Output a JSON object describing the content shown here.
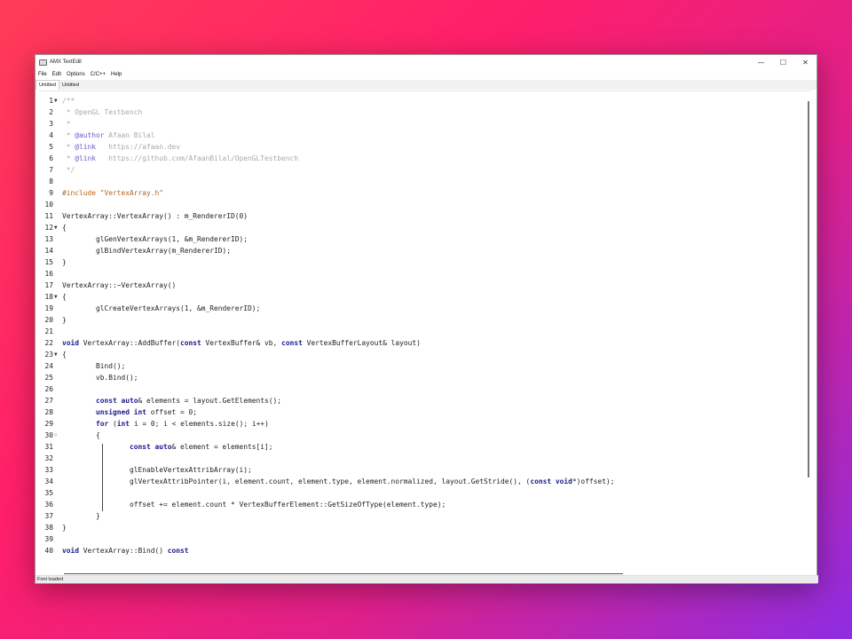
{
  "window": {
    "title": "AMX TextEdit",
    "controls": {
      "minimize": "—",
      "maximize": "☐",
      "close": "✕"
    }
  },
  "menu": [
    "File",
    "Edit",
    "Options",
    "C/C++",
    "Help"
  ],
  "tabs": [
    {
      "label": "Untitled",
      "active": true
    },
    {
      "label": "Untitled",
      "active": false
    }
  ],
  "status": "Font loaded",
  "icons": {
    "app": "text-editor-icon",
    "fold_open": "triangle-down-icon",
    "fold_inner": "triangle-down-outline-icon"
  },
  "colors": {
    "comment": "#a9a9a9",
    "tag": "#6a5acd",
    "preprocessor": "#b5651d",
    "keyword": "#1a1a8c",
    "text": "#222222"
  },
  "code_lines": [
    {
      "n": "1",
      "fold": "open",
      "tokens": [
        [
          "comment",
          "/**"
        ]
      ]
    },
    {
      "n": "2",
      "tokens": [
        [
          "comment",
          " * OpenGL Testbench"
        ]
      ]
    },
    {
      "n": "3",
      "tokens": [
        [
          "comment",
          " *"
        ]
      ]
    },
    {
      "n": "4",
      "tokens": [
        [
          "comment",
          " * "
        ],
        [
          "tag",
          "@author"
        ],
        [
          "comment",
          " Afaan Bilal"
        ]
      ]
    },
    {
      "n": "5",
      "tokens": [
        [
          "comment",
          " * "
        ],
        [
          "tag",
          "@link"
        ],
        [
          "comment",
          "   https://afaan.dev"
        ]
      ]
    },
    {
      "n": "6",
      "tokens": [
        [
          "comment",
          " * "
        ],
        [
          "tag",
          "@link"
        ],
        [
          "comment",
          "   https://github.com/AfaanBilal/OpenGLTestbench"
        ]
      ]
    },
    {
      "n": "7",
      "tokens": [
        [
          "comment",
          " */"
        ]
      ]
    },
    {
      "n": "8",
      "tokens": []
    },
    {
      "n": "9",
      "tokens": [
        [
          "pre",
          "#include \"VertexArray.h\""
        ]
      ]
    },
    {
      "n": "10",
      "tokens": []
    },
    {
      "n": "11",
      "tokens": [
        [
          "plain",
          "VertexArray::VertexArray() : m_RendererID(0)"
        ]
      ]
    },
    {
      "n": "12",
      "fold": "open",
      "tokens": [
        [
          "plain",
          "{"
        ]
      ]
    },
    {
      "n": "13",
      "tokens": [
        [
          "plain",
          "        glGenVertexArrays(1, &m_RendererID);"
        ]
      ]
    },
    {
      "n": "14",
      "tokens": [
        [
          "plain",
          "        glBindVertexArray(m_RendererID);"
        ]
      ]
    },
    {
      "n": "15",
      "tokens": [
        [
          "plain",
          "}"
        ]
      ]
    },
    {
      "n": "16",
      "tokens": []
    },
    {
      "n": "17",
      "tokens": [
        [
          "plain",
          "VertexArray::~VertexArray()"
        ]
      ]
    },
    {
      "n": "18",
      "fold": "open",
      "tokens": [
        [
          "plain",
          "{"
        ]
      ]
    },
    {
      "n": "19",
      "tokens": [
        [
          "plain",
          "        glCreateVertexArrays(1, &m_RendererID);"
        ]
      ]
    },
    {
      "n": "20",
      "tokens": [
        [
          "plain",
          "}"
        ]
      ]
    },
    {
      "n": "21",
      "tokens": []
    },
    {
      "n": "22",
      "tokens": [
        [
          "kw",
          "void"
        ],
        [
          "plain",
          " VertexArray::AddBuffer("
        ],
        [
          "kw",
          "const"
        ],
        [
          "plain",
          " VertexBuffer& vb, "
        ],
        [
          "kw",
          "const"
        ],
        [
          "plain",
          " VertexBufferLayout& layout)"
        ]
      ]
    },
    {
      "n": "23",
      "fold": "open",
      "tokens": [
        [
          "plain",
          "{"
        ]
      ]
    },
    {
      "n": "24",
      "tokens": [
        [
          "plain",
          "        Bind();"
        ]
      ]
    },
    {
      "n": "25",
      "tokens": [
        [
          "plain",
          "        vb.Bind();"
        ]
      ]
    },
    {
      "n": "26",
      "tokens": []
    },
    {
      "n": "27",
      "tokens": [
        [
          "plain",
          "        "
        ],
        [
          "kw",
          "const auto"
        ],
        [
          "plain",
          "& elements = layout.GetElements();"
        ]
      ]
    },
    {
      "n": "28",
      "tokens": [
        [
          "plain",
          "        "
        ],
        [
          "kw",
          "unsigned int"
        ],
        [
          "plain",
          " offset = 0;"
        ]
      ]
    },
    {
      "n": "29",
      "tokens": [
        [
          "plain",
          "        "
        ],
        [
          "kw",
          "for"
        ],
        [
          "plain",
          " ("
        ],
        [
          "kw",
          "int"
        ],
        [
          "plain",
          " i = 0; i < elements.size(); i++)"
        ]
      ]
    },
    {
      "n": "30",
      "fold": "inner",
      "tokens": [
        [
          "plain",
          "        {"
        ]
      ]
    },
    {
      "n": "31",
      "tokens": [
        [
          "plain",
          "                "
        ],
        [
          "kw",
          "const auto"
        ],
        [
          "plain",
          "& element = elements[i];"
        ]
      ]
    },
    {
      "n": "32",
      "tokens": []
    },
    {
      "n": "33",
      "tokens": [
        [
          "plain",
          "                glEnableVertexAttribArray(i);"
        ]
      ]
    },
    {
      "n": "34",
      "tokens": [
        [
          "plain",
          "                glVertexAttribPointer(i, element.count, element.type, element.normalized, layout.GetStride(), ("
        ],
        [
          "kw",
          "const void"
        ],
        [
          "plain",
          "*)offset);"
        ]
      ]
    },
    {
      "n": "35",
      "tokens": []
    },
    {
      "n": "36",
      "tokens": [
        [
          "plain",
          "                offset += element.count * VertexBufferElement::GetSizeOfType(element.type);"
        ]
      ]
    },
    {
      "n": "37",
      "tokens": [
        [
          "plain",
          "        }"
        ]
      ]
    },
    {
      "n": "38",
      "tokens": [
        [
          "plain",
          "}"
        ]
      ]
    },
    {
      "n": "39",
      "tokens": []
    },
    {
      "n": "40",
      "tokens": [
        [
          "kw",
          "void"
        ],
        [
          "plain",
          " VertexArray::Bind() "
        ],
        [
          "kw",
          "const"
        ]
      ]
    }
  ]
}
